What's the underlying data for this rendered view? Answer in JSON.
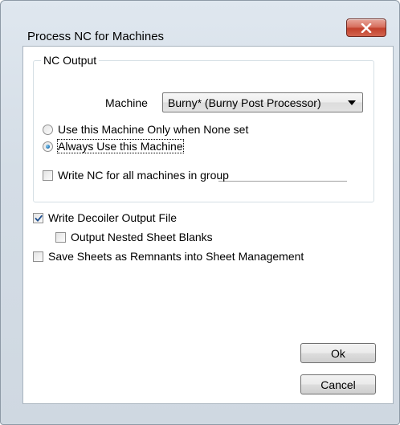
{
  "window": {
    "title": "Process NC for Machines",
    "close_icon": "close-x-icon"
  },
  "nc_output": {
    "legend": "NC Output",
    "machine_label": "Machine",
    "machine_value": "Burny* (Burny Post Processor)",
    "radio_none_set": "Use this Machine Only when None set",
    "radio_always": "Always Use this Machine",
    "radio_selected": "always",
    "write_nc_all": "Write NC for all machines in group",
    "write_nc_all_checked": false
  },
  "options": {
    "write_decoiler": "Write Decoiler Output File",
    "write_decoiler_checked": true,
    "output_nested": "Output Nested Sheet Blanks",
    "output_nested_checked": false,
    "save_remnants": "Save Sheets as Remnants into Sheet Management",
    "save_remnants_checked": false
  },
  "buttons": {
    "ok": "Ok",
    "cancel": "Cancel"
  }
}
